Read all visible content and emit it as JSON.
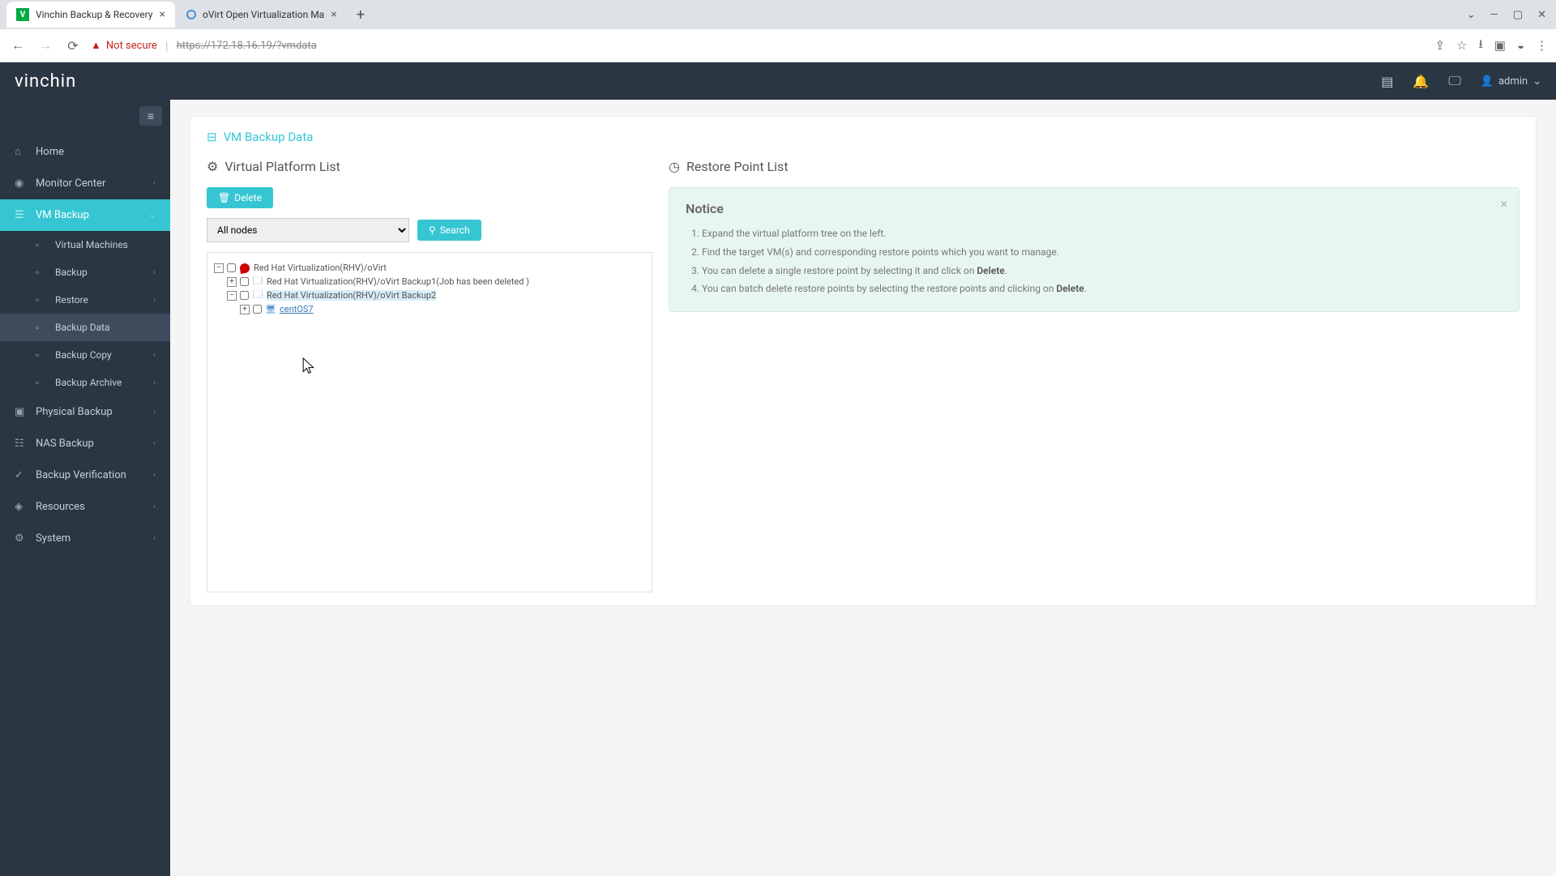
{
  "browser": {
    "tabs": [
      {
        "title": "Vinchin Backup & Recovery"
      },
      {
        "title": "oVirt Open Virtualization Ma"
      }
    ],
    "secure_label": "Not secure",
    "url": "https://172.18.16.19/?vmdata"
  },
  "header": {
    "logo": "vinchin",
    "user": "admin"
  },
  "sidebar": {
    "items": [
      {
        "label": "Home"
      },
      {
        "label": "Monitor Center"
      },
      {
        "label": "VM Backup"
      },
      {
        "label": "Physical Backup"
      },
      {
        "label": "NAS Backup"
      },
      {
        "label": "Backup Verification"
      },
      {
        "label": "Resources"
      },
      {
        "label": "System"
      }
    ],
    "sub_vm": [
      {
        "label": "Virtual Machines"
      },
      {
        "label": "Backup"
      },
      {
        "label": "Restore"
      },
      {
        "label": "Backup Data"
      },
      {
        "label": "Backup Copy"
      },
      {
        "label": "Backup Archive"
      }
    ]
  },
  "page": {
    "title": "VM Backup Data",
    "platform_title": "Virtual Platform List",
    "restore_title": "Restore Point List",
    "delete_btn": "Delete",
    "search_btn": "Search",
    "node_select": "All nodes"
  },
  "tree": {
    "root": "Red Hat Virtualization(RHV)/oVirt",
    "job1": "Red Hat Virtualization(RHV)/oVirt Backup1(Job has been deleted )",
    "job2": "Red Hat Virtualization(RHV)/oVirt Backup2",
    "vm1": "centOS7"
  },
  "notice": {
    "title": "Notice",
    "items": [
      {
        "text": "Expand the virtual platform tree on the left."
      },
      {
        "text": "Find the target VM(s) and corresponding restore points which you want to manage."
      },
      {
        "text_a": "You can delete a single restore point by selecting it and click on ",
        "bold": "Delete",
        "text_b": "."
      },
      {
        "text_a": "You can batch delete restore points by selecting the restore points and clicking on ",
        "bold": "Delete",
        "text_b": "."
      }
    ]
  }
}
